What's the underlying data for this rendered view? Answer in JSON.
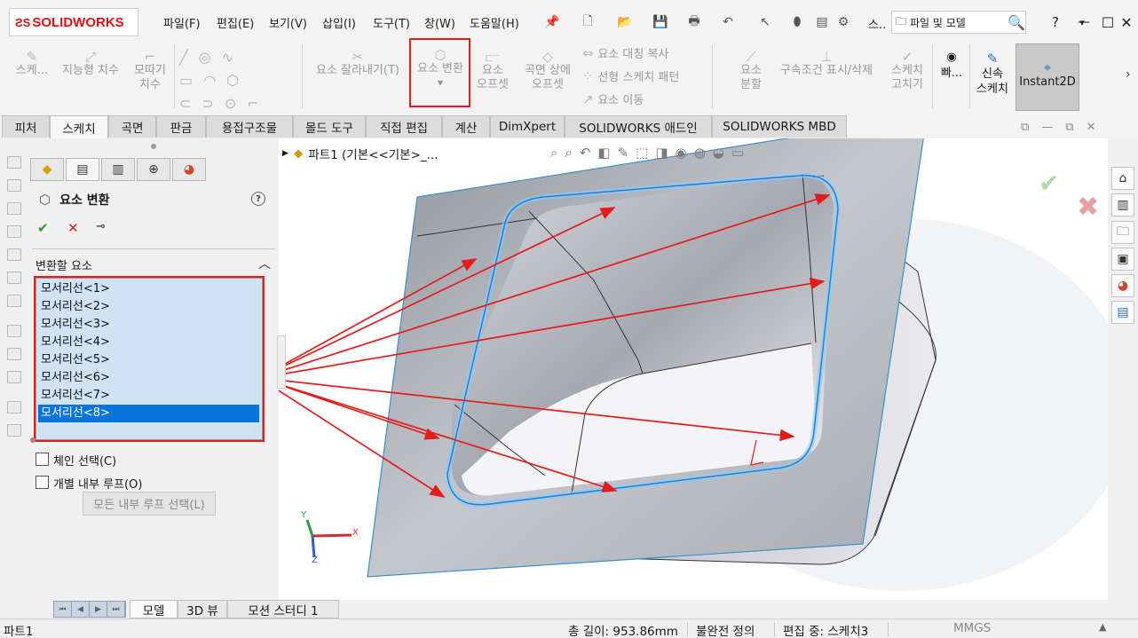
{
  "app": {
    "logo": "SOLIDWORKS"
  },
  "menu": [
    "파일(F)",
    "편집(E)",
    "보기(V)",
    "삽입(I)",
    "도구(T)",
    "창(W)",
    "도움말(H)"
  ],
  "search": {
    "prefix": "스..",
    "placeholder": "파일 및 모델"
  },
  "window": {
    "help": "?",
    "minimize": "—",
    "maximize": "☐",
    "close": "✕"
  },
  "toolbar": {
    "sketch": "스케...",
    "smart_dim": "지능형 치수",
    "fillet": [
      "모따기",
      "치수"
    ],
    "trim": "요소 잘라내기(T)",
    "convert": "요소 변환",
    "offset": [
      "요소",
      "오프셋"
    ],
    "offset_surface": [
      "곡면 상에",
      "오프셋"
    ],
    "mirror": "요소 대칭 복사",
    "linear_pattern": "선형 스케치 패턴",
    "move": "요소 이동",
    "split": [
      "요소",
      "분할"
    ],
    "relations": "구속조건 표시/삭제",
    "repair": [
      "스케치",
      "고치기"
    ],
    "rapid": "빠...",
    "quick_sketch": [
      "신속",
      "스케치"
    ],
    "instant2d": "Instant2D"
  },
  "tabs": [
    "피처",
    "스케치",
    "곡면",
    "판금",
    "용접구조물",
    "몰드 도구",
    "직접 편집",
    "계산",
    "DimXpert",
    "SOLIDWORKS 애드인",
    "SOLIDWORKS MBD"
  ],
  "active_tab": "스케치",
  "property_manager": {
    "title": "요소 변환",
    "help": "?",
    "group": "변환할 요소",
    "edges": [
      "모서리선<1>",
      "모서리선<2>",
      "모서리선<3>",
      "모서리선<4>",
      "모서리선<5>",
      "모서리선<6>",
      "모서리선<7>",
      "모서리선<8>"
    ],
    "selected_edge": "모서리선<8>",
    "chain": "체인 선택(C)",
    "inner_loops": "개별 내부 루프(O)",
    "all_inner_loops": "모든 내부 루프 선택(L)"
  },
  "viewport": {
    "tree_label": "파트1  (기본<<기본>_..."
  },
  "triad": {
    "x": "X",
    "y": "Y",
    "z": "Z"
  },
  "bottom_tabs": [
    "모델",
    "3D 뷰",
    "모션 스터디 1"
  ],
  "active_bottom_tab": "모델",
  "status": {
    "doc": "파트1",
    "length": "총 길이: 953.86mm",
    "definition": "불완전 정의",
    "editing": "편집 중: 스케치3",
    "units": "MMGS"
  },
  "colors": {
    "highlight_red": "#e31c1c",
    "selection_blue": "#0a74d8",
    "list_bg": "#cfe3f5",
    "edge_glow": "#7fd0ff"
  }
}
